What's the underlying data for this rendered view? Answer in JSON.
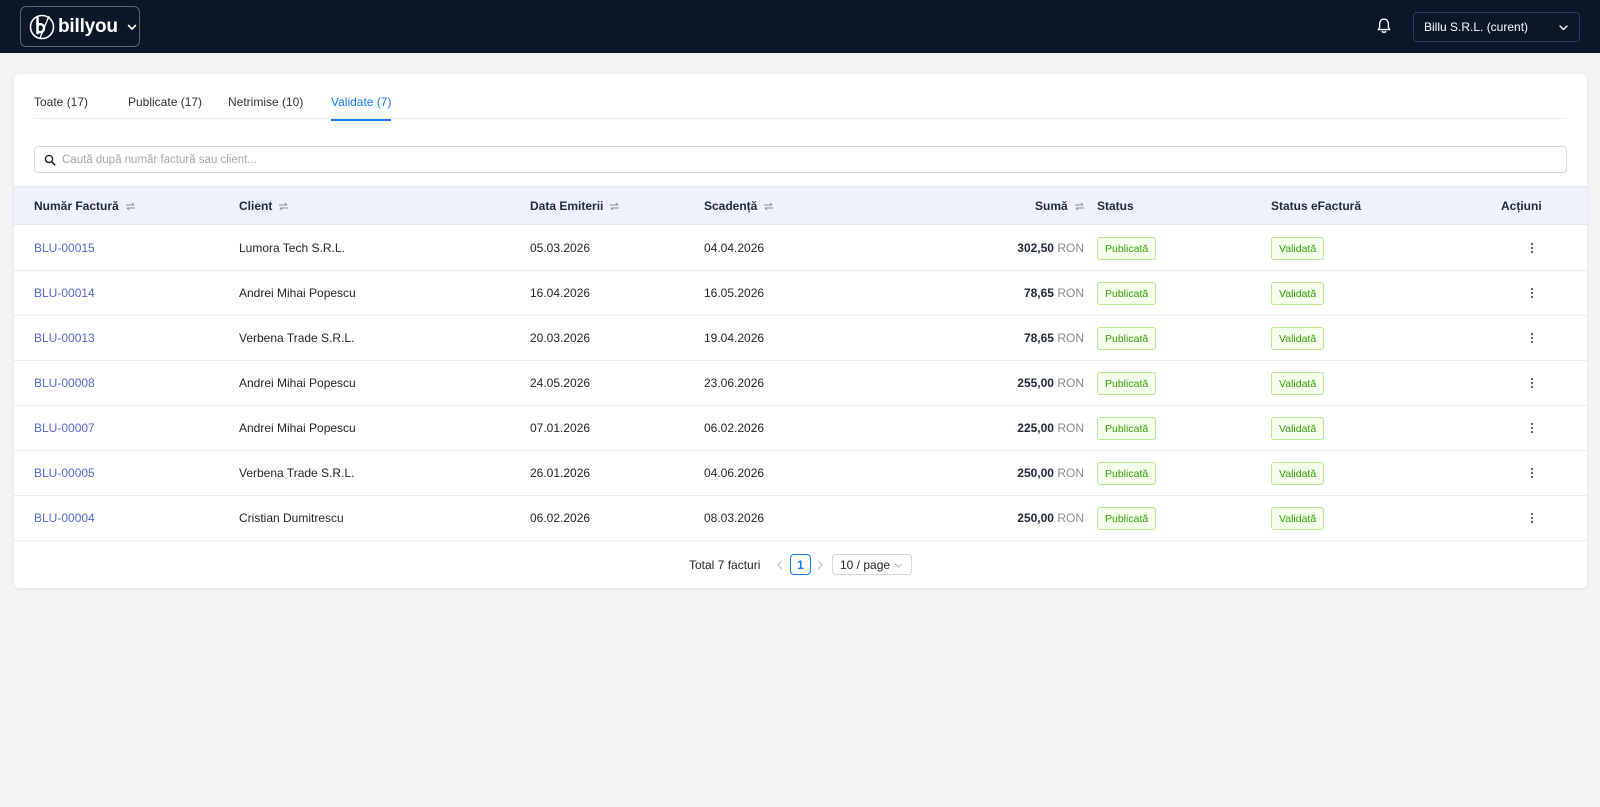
{
  "header": {
    "brand_name": "billyou",
    "company_select": "Billu S.R.L. (curent)"
  },
  "tabs": [
    {
      "label": "Toate (17)",
      "active": false
    },
    {
      "label": "Publicate (17)",
      "active": false
    },
    {
      "label": "Netrimise (10)",
      "active": false
    },
    {
      "label": "Validate (7)",
      "active": true
    }
  ],
  "search": {
    "placeholder": "Caută după număr factură sau client...",
    "value": ""
  },
  "table": {
    "columns": [
      "Număr Factură",
      "Client",
      "Data Emiterii",
      "Scadență",
      "Sumă",
      "Status",
      "Status eFactură",
      "Acțiuni"
    ],
    "rows": [
      {
        "number": "BLU-00015",
        "client": "Lumora Tech S.R.L.",
        "issued": "05.03.2026",
        "due": "04.04.2026",
        "amount": "302,50",
        "currency": "RON",
        "status": "Publicată",
        "efactura": "Validată"
      },
      {
        "number": "BLU-00014",
        "client": "Andrei Mihai Popescu",
        "issued": "16.04.2026",
        "due": "16.05.2026",
        "amount": "78,65",
        "currency": "RON",
        "status": "Publicată",
        "efactura": "Validată"
      },
      {
        "number": "BLU-00013",
        "client": "Verbena Trade S.R.L.",
        "issued": "20.03.2026",
        "due": "19.04.2026",
        "amount": "78,65",
        "currency": "RON",
        "status": "Publicată",
        "efactura": "Validată"
      },
      {
        "number": "BLU-00008",
        "client": "Andrei Mihai Popescu",
        "issued": "24.05.2026",
        "due": "23.06.2026",
        "amount": "255,00",
        "currency": "RON",
        "status": "Publicată",
        "efactura": "Validată"
      },
      {
        "number": "BLU-00007",
        "client": "Andrei Mihai Popescu",
        "issued": "07.01.2026",
        "due": "06.02.2026",
        "amount": "225,00",
        "currency": "RON",
        "status": "Publicată",
        "efactura": "Validată"
      },
      {
        "number": "BLU-00005",
        "client": "Verbena Trade S.R.L.",
        "issued": "26.01.2026",
        "due": "04.06.2026",
        "amount": "250,00",
        "currency": "RON",
        "status": "Publicată",
        "efactura": "Validată"
      },
      {
        "number": "BLU-00004",
        "client": "Cristian Dumitrescu",
        "issued": "06.02.2026",
        "due": "08.03.2026",
        "amount": "250,00",
        "currency": "RON",
        "status": "Publicată",
        "efactura": "Validată"
      }
    ]
  },
  "pagination": {
    "total": "Total 7 facturi",
    "current_page": "1",
    "page_size": "10 / page"
  },
  "icons": {
    "brand_logo": "billyou-logo-icon",
    "bell": "bell-icon",
    "search": "search-icon",
    "sort": "sort-icon",
    "more": "more-vertical-icon"
  },
  "colors": {
    "topbar": "#0b1728",
    "accent": "#1677ff",
    "link": "#5a67d8",
    "success": "#389e0d",
    "table_header": "#eef2fc"
  }
}
